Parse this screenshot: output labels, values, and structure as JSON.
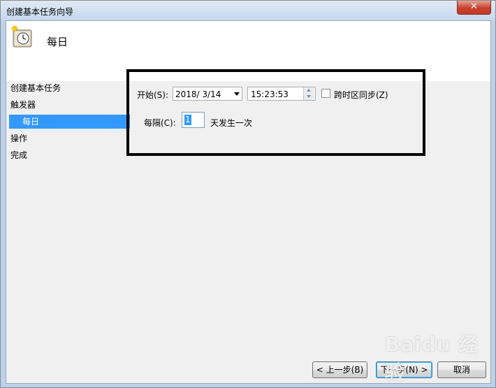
{
  "window": {
    "title": "创建基本任务向导",
    "close_symbol": "✕"
  },
  "header": {
    "title": "每日"
  },
  "nav": {
    "items": [
      {
        "label": "创建基本任务",
        "selected": false
      },
      {
        "label": "触发器",
        "selected": false
      },
      {
        "label": "每日",
        "selected": true
      },
      {
        "label": "操作",
        "selected": false
      },
      {
        "label": "完成",
        "selected": false
      }
    ]
  },
  "trigger": {
    "start_label": "开始(S):",
    "start_date": "2018/  3/14",
    "start_time": "15:23:53",
    "sync_timezones_label": "跨时区同步(Z)",
    "sync_timezones_checked": false,
    "recur_label": "每隔(C):",
    "recur_value": "1",
    "recur_suffix": "天发生一次"
  },
  "buttons": {
    "back": "< 上一步(B)",
    "next": "下一步(N) >",
    "cancel": "取消"
  },
  "watermark": "Baidu 经验",
  "colors": {
    "selection": "#3399ff",
    "annotation_box": "#000000",
    "client_bg": "#f0f0f0"
  }
}
